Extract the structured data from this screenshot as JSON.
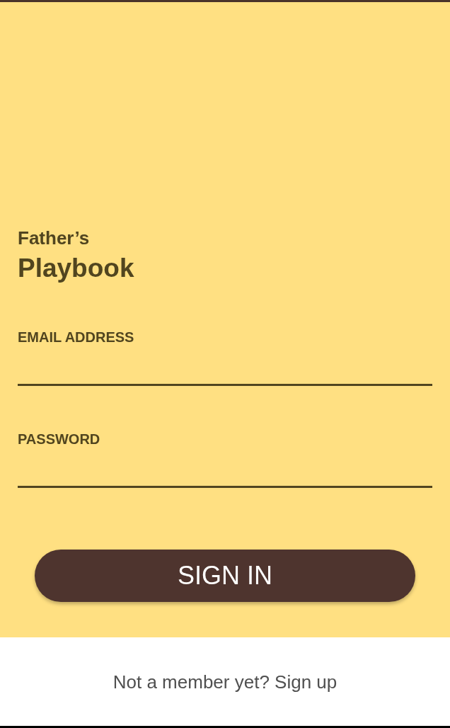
{
  "brand": {
    "line_1": "Father’s",
    "line_2": "Playbook"
  },
  "fields": [
    {
      "label": "EMAIL ADDRESS"
    },
    {
      "label": "PASSWORD"
    }
  ],
  "sign_in_button": {
    "label": "SIGN IN"
  },
  "footer": {
    "text": "Not a member yet? Sign up"
  }
}
